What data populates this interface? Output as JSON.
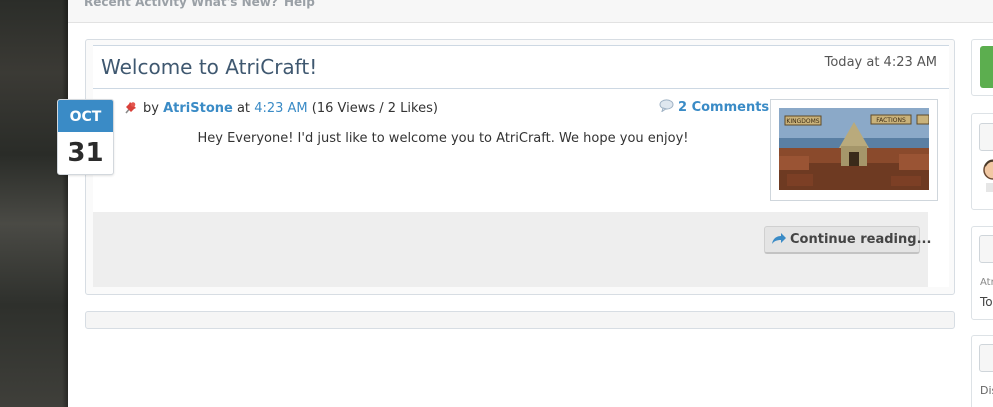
{
  "nav": {
    "tabs": [
      "Recent Activity",
      "What's New?",
      "Help"
    ]
  },
  "post": {
    "title": "Welcome to AtriCraft!",
    "date": "Today at 4:23 AM",
    "badge": {
      "month": "OCT",
      "day": "31"
    },
    "meta": {
      "by_prefix": "by",
      "author": "AtriStone",
      "at": "at",
      "time": "4:23 AM",
      "stats": "(16 Views / 2 Likes)"
    },
    "comments_label": "2 Comments",
    "body": "Hey Everyone! I'd just like to welcome you to AtriCraft. We hope you enjoy!",
    "continue_label": "Continue reading...",
    "thumbnail": {
      "sign_left": "KINGDOMS",
      "sign_right": "FACTIONS"
    }
  },
  "sidebar": {
    "snippet_1": "Atr",
    "snippet_2": "To",
    "snippet_3": "Dis"
  },
  "colors": {
    "accent": "#3a8bc6",
    "title": "#3f5870",
    "green": "#5cae4f"
  }
}
